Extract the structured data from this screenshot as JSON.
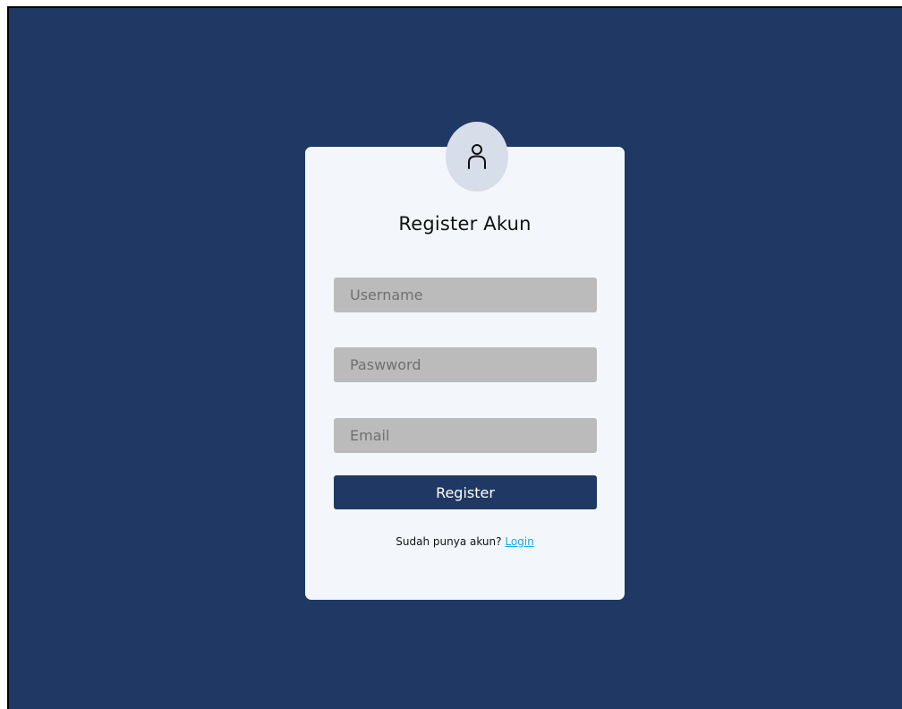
{
  "form": {
    "title": "Register Akun",
    "username_placeholder": "Username",
    "password_placeholder": "Paswword",
    "email_placeholder": "Email",
    "submit_label": "Register",
    "footer_prompt": "Sudah punya akun?",
    "footer_link": "Login"
  },
  "icons": {
    "avatar": "user-icon"
  },
  "colors": {
    "background": "#1f3964",
    "card": "#f3f7fc",
    "avatar_bg": "#d7dde9",
    "field_bg": "#bbbbbb",
    "button_bg": "#1f3964",
    "link": "#1aa6e6"
  }
}
